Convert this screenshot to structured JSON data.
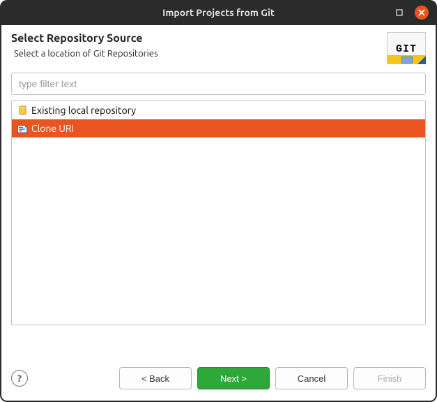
{
  "window": {
    "title": "Import Projects from Git"
  },
  "header": {
    "title": "Select Repository Source",
    "subtitle": "Select a location of Git Repositories",
    "badge": "GIT"
  },
  "filter": {
    "placeholder": "type filter text",
    "value": ""
  },
  "options": [
    {
      "icon": "repo-local-icon",
      "label": "Existing local repository",
      "selected": false
    },
    {
      "icon": "repo-clone-icon",
      "label": "Clone URI",
      "selected": true
    }
  ],
  "footer": {
    "help": "?",
    "back": "< Back",
    "next": "Next >",
    "cancel": "Cancel",
    "finish": "Finish"
  }
}
